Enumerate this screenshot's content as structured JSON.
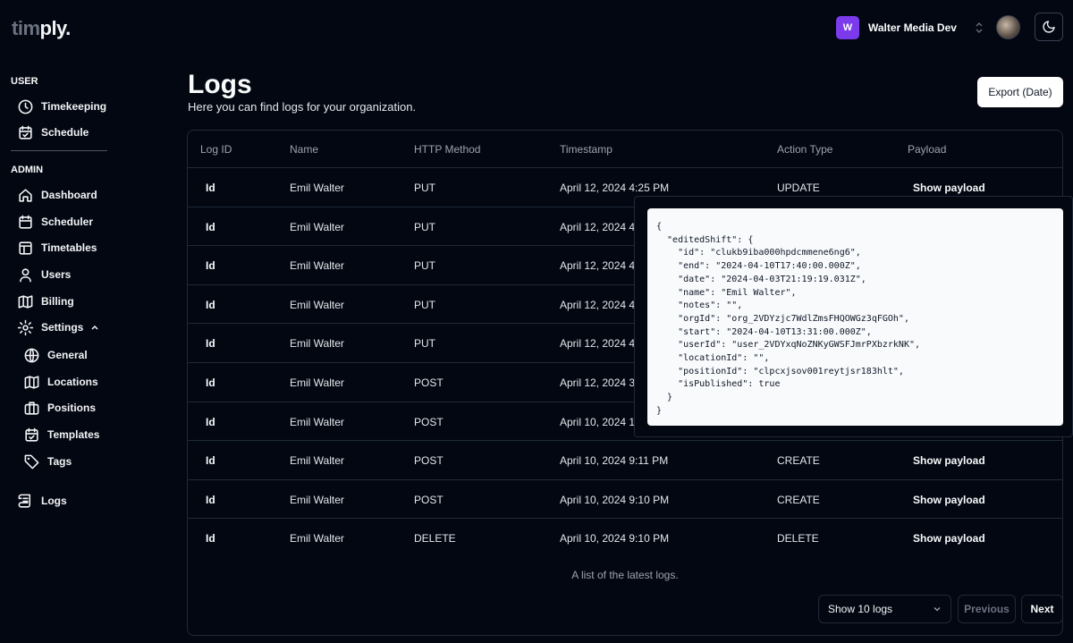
{
  "brand": {
    "prefix": "tim",
    "suffix": "ply."
  },
  "org": {
    "initial": "W",
    "name": "Walter Media Dev"
  },
  "sidebar": {
    "user_title": "USER",
    "user_items": [
      {
        "label": "Timekeeping",
        "icon": "clock-icon"
      },
      {
        "label": "Schedule",
        "icon": "calendar-check-icon"
      }
    ],
    "admin_title": "ADMIN",
    "admin_items": [
      {
        "label": "Dashboard",
        "icon": "home-icon"
      },
      {
        "label": "Scheduler",
        "icon": "calendar-icon"
      },
      {
        "label": "Timetables",
        "icon": "table-icon"
      },
      {
        "label": "Users",
        "icon": "user-icon"
      },
      {
        "label": "Billing",
        "icon": "map-icon"
      },
      {
        "label": "Settings",
        "icon": "gear-icon"
      }
    ],
    "settings_items": [
      {
        "label": "General",
        "icon": "globe-icon"
      },
      {
        "label": "Locations",
        "icon": "map-icon"
      },
      {
        "label": "Positions",
        "icon": "briefcase-icon"
      },
      {
        "label": "Templates",
        "icon": "calendar-check-icon"
      },
      {
        "label": "Tags",
        "icon": "tag-icon"
      }
    ],
    "logs_label": "Logs"
  },
  "page": {
    "title": "Logs",
    "subtitle": "Here you can find logs for your organization.",
    "export_label": "Export (Date)"
  },
  "table": {
    "headers": [
      "Log ID",
      "Name",
      "HTTP Method",
      "Timestamp",
      "Action Type",
      "Payload"
    ],
    "rows": [
      {
        "id": "Id",
        "name": "Emil Walter",
        "method": "PUT",
        "timestamp": "April 12, 2024 4:25 PM",
        "action": "UPDATE",
        "payload": "Show payload"
      },
      {
        "id": "Id",
        "name": "Emil Walter",
        "method": "PUT",
        "timestamp": "April 12, 2024 4:",
        "action": "",
        "payload": ""
      },
      {
        "id": "Id",
        "name": "Emil Walter",
        "method": "PUT",
        "timestamp": "April 12, 2024 4:",
        "action": "",
        "payload": ""
      },
      {
        "id": "Id",
        "name": "Emil Walter",
        "method": "PUT",
        "timestamp": "April 12, 2024 4:",
        "action": "",
        "payload": ""
      },
      {
        "id": "Id",
        "name": "Emil Walter",
        "method": "PUT",
        "timestamp": "April 12, 2024 4:",
        "action": "",
        "payload": ""
      },
      {
        "id": "Id",
        "name": "Emil Walter",
        "method": "POST",
        "timestamp": "April 12, 2024 3:",
        "action": "",
        "payload": ""
      },
      {
        "id": "Id",
        "name": "Emil Walter",
        "method": "POST",
        "timestamp": "April 10, 2024 10",
        "action": "",
        "payload": ""
      },
      {
        "id": "Id",
        "name": "Emil Walter",
        "method": "POST",
        "timestamp": "April 10, 2024 9:11 PM",
        "action": "CREATE",
        "payload": "Show payload"
      },
      {
        "id": "Id",
        "name": "Emil Walter",
        "method": "POST",
        "timestamp": "April 10, 2024 9:10 PM",
        "action": "CREATE",
        "payload": "Show payload"
      },
      {
        "id": "Id",
        "name": "Emil Walter",
        "method": "DELETE",
        "timestamp": "April 10, 2024 9:10 PM",
        "action": "DELETE",
        "payload": "Show payload"
      }
    ],
    "caption": "A list of the latest logs."
  },
  "pagination": {
    "page_size_label": "Show 10 logs",
    "previous": "Previous",
    "next": "Next"
  },
  "payload_json": "{\n  \"editedShift\": {\n    \"id\": \"clukb9iba000hpdcmmene6ng6\",\n    \"end\": \"2024-04-10T17:40:00.000Z\",\n    \"date\": \"2024-04-03T21:19:19.031Z\",\n    \"name\": \"Emil Walter\",\n    \"notes\": \"\",\n    \"orgId\": \"org_2VDYzjc7WdlZmsFHQOWGz3qFGOh\",\n    \"start\": \"2024-04-10T13:31:00.000Z\",\n    \"userId\": \"user_2VDYxqNoZNKyGWSFJmrPXbzrkNK\",\n    \"locationId\": \"\",\n    \"positionId\": \"clpcxjsov001reytjsr183hlt\",\n    \"isPublished\": true\n  }\n}",
  "colors": {
    "background": "#030712",
    "accent": "#7c3aed",
    "border": "#1f2937"
  }
}
